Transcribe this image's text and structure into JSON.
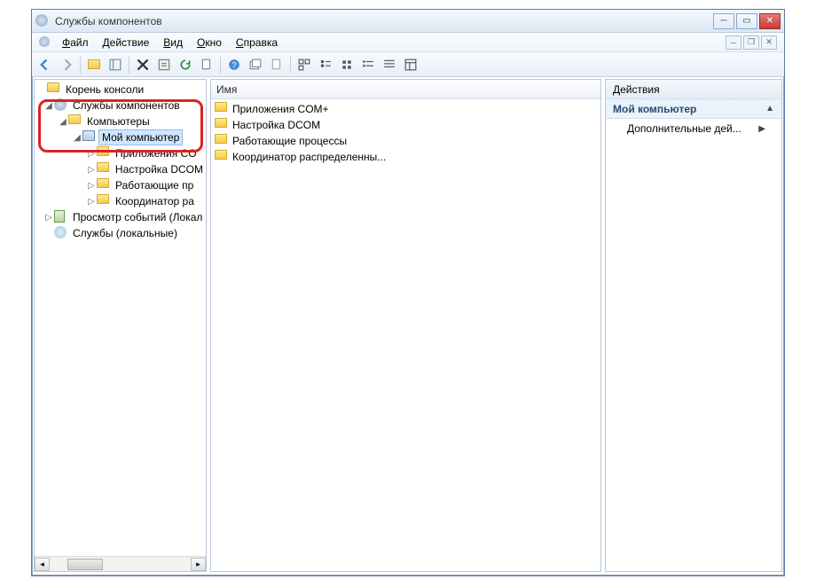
{
  "window": {
    "title": "Службы компонентов"
  },
  "menu": {
    "items": [
      "Файл",
      "Действие",
      "Вид",
      "Окно",
      "Справка"
    ]
  },
  "tree": {
    "root": "Корень консоли",
    "nodes": [
      {
        "label": "Службы компонентов",
        "icon": "gear",
        "depth": 1,
        "expanded": true
      },
      {
        "label": "Компьютеры",
        "icon": "folder",
        "depth": 2,
        "expanded": true
      },
      {
        "label": "Мой компьютер",
        "icon": "comp",
        "depth": 3,
        "expanded": true,
        "selected": true
      },
      {
        "label": "Приложения CO",
        "icon": "folder",
        "depth": 4,
        "expanded": false
      },
      {
        "label": "Настройка DCOM",
        "icon": "folder",
        "depth": 4,
        "expanded": false
      },
      {
        "label": "Работающие пр",
        "icon": "folder",
        "depth": 4,
        "expanded": false
      },
      {
        "label": "Координатор ра",
        "icon": "folder",
        "depth": 4,
        "expanded": false
      },
      {
        "label": "Просмотр событий (Локал",
        "icon": "log",
        "depth": 1,
        "expanded": false
      },
      {
        "label": "Службы (локальные)",
        "icon": "svc",
        "depth": 1,
        "expanded": null
      }
    ]
  },
  "list": {
    "header": "Имя",
    "items": [
      "Приложения COM+",
      "Настройка DCOM",
      "Работающие процессы",
      "Координатор распределенны..."
    ]
  },
  "actions": {
    "header": "Действия",
    "context": "Мой компьютер",
    "items": [
      "Дополнительные дей..."
    ]
  }
}
